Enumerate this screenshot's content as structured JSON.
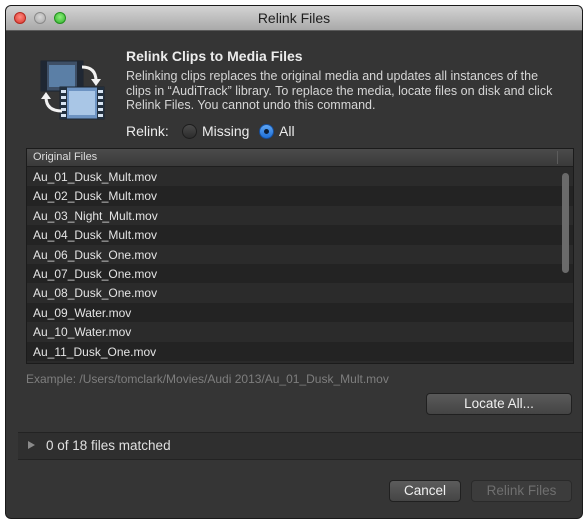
{
  "window": {
    "title": "Relink Files"
  },
  "icons": {
    "app": "relink-clips-icon",
    "disclosure": "disclosure-triangle-icon"
  },
  "header": {
    "heading": "Relink Clips to Media Files",
    "description": "Relinking clips replaces the original media and updates all instances of the clips in “AudiTrack” library. To replace the media, locate files on disk and click Relink Files. You cannot undo this command."
  },
  "relink": {
    "label": "Relink:",
    "options": [
      "Missing",
      "All"
    ],
    "selected": "All"
  },
  "file_list": {
    "column_header": "Original Files",
    "files": [
      "Au_01_Dusk_Mult.mov",
      "Au_02_Dusk_Mult.mov",
      "Au_03_Night_Mult.mov",
      "Au_04_Dusk_Mult.mov",
      "Au_06_Dusk_One.mov",
      "Au_07_Dusk_One.mov",
      "Au_08_Dusk_One.mov",
      "Au_09_Water.mov",
      "Au_10_Water.mov",
      "Au_11_Dusk_One.mov"
    ]
  },
  "example_path": "Example: /Users/tomclark/Movies/Audi 2013/Au_01_Dusk_Mult.mov",
  "buttons": {
    "locate_all": "Locate All...",
    "cancel": "Cancel",
    "relink_files": "Relink Files"
  },
  "matched_status": "0 of 18 files matched",
  "colors": {
    "window_bg": "#353535",
    "accent_blue": "#2a7be4",
    "disabled_text": "#6f6f6f"
  }
}
